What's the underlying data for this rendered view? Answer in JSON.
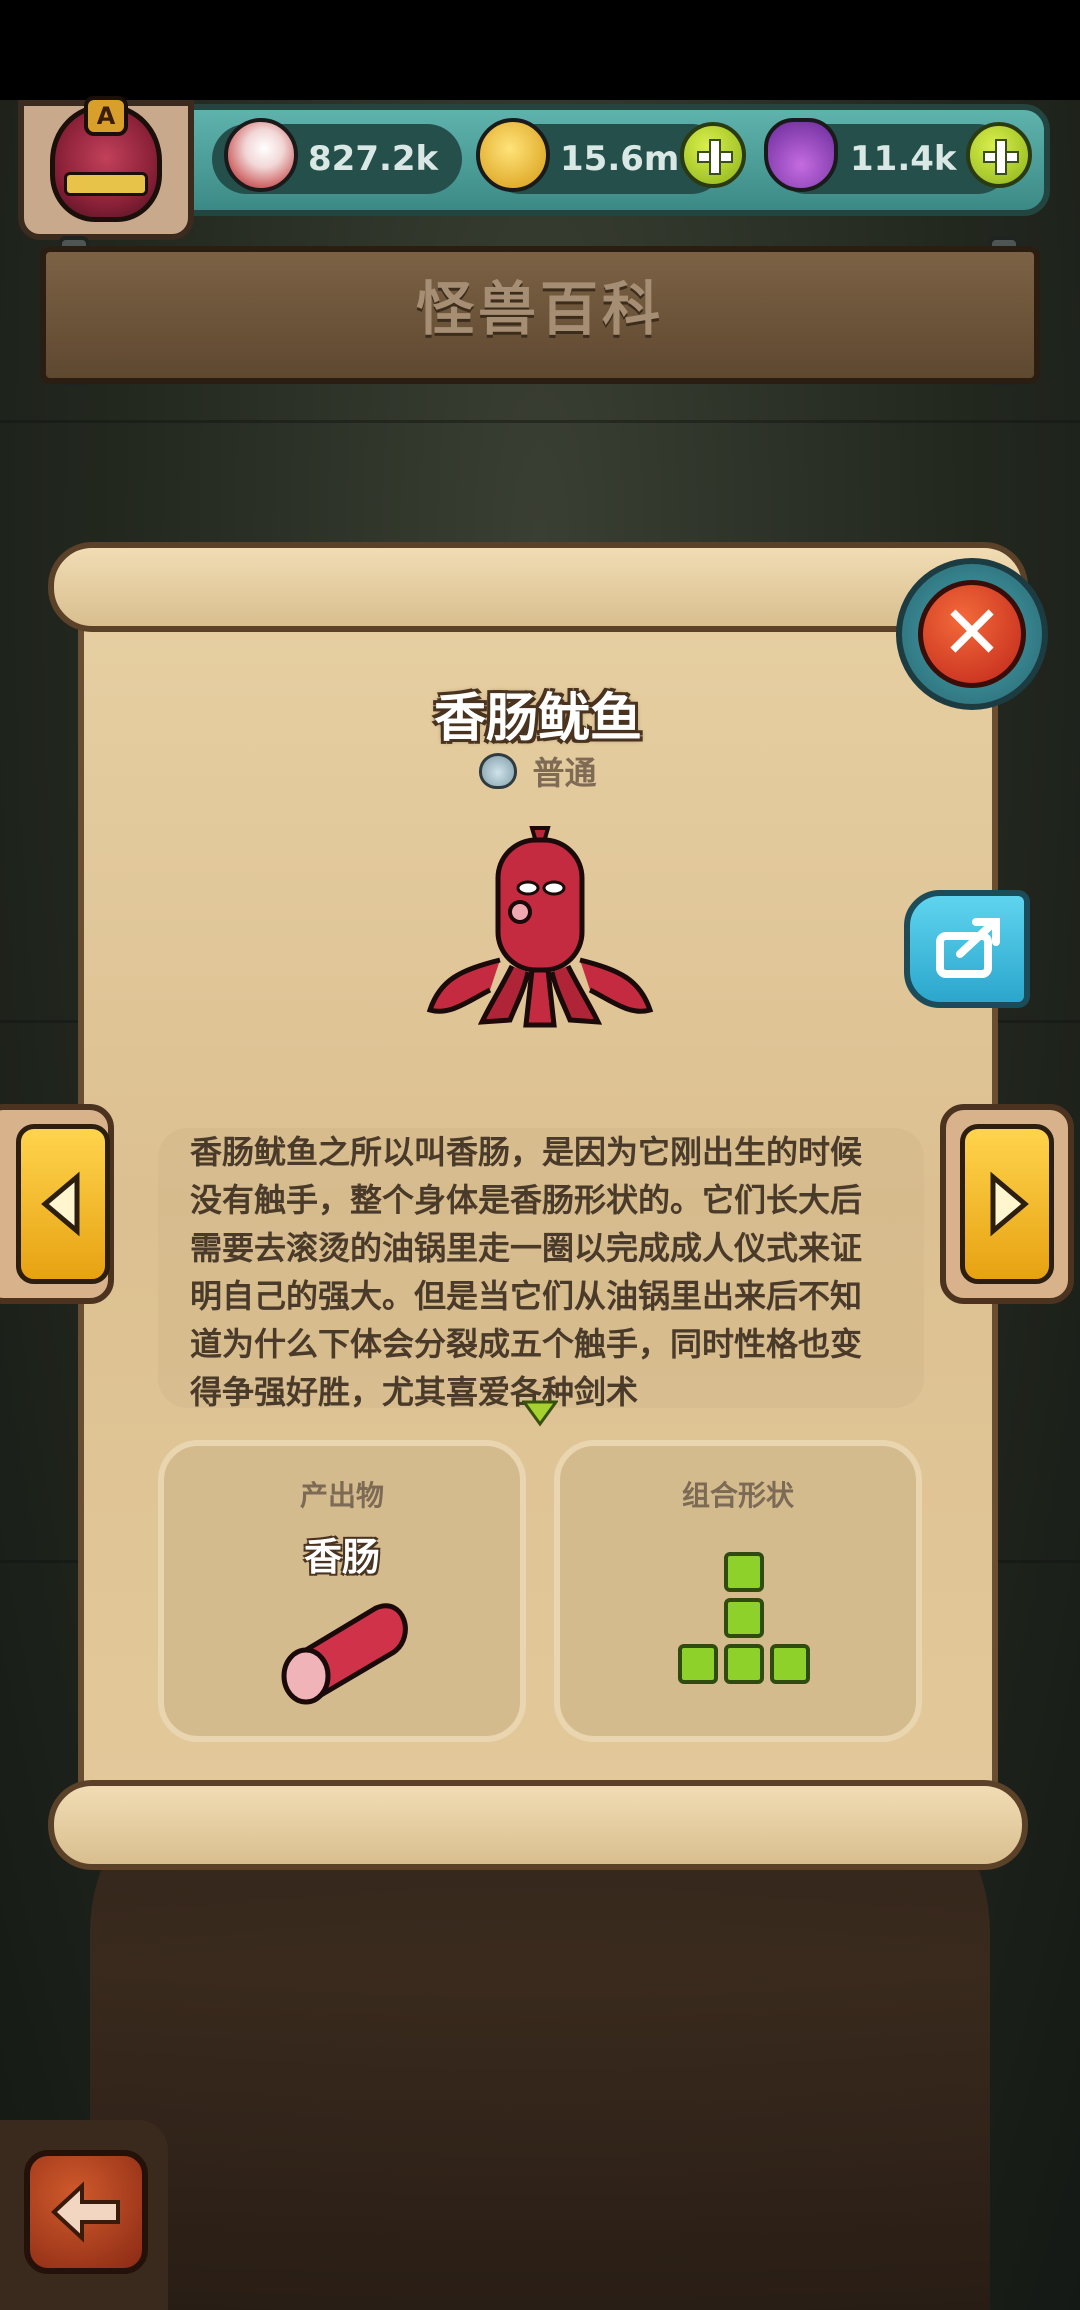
{
  "resources": {
    "eyeballs": "827.2k",
    "coins": "15.6m",
    "potions": "11.4k"
  },
  "avatar": {
    "rank": "A"
  },
  "page": {
    "title": "怪兽百科"
  },
  "monster": {
    "name": "香肠鱿鱼",
    "rarity": "普通",
    "description": "香肠鱿鱼之所以叫香肠，是因为它刚出生的时候没有触手，整个身体是香肠形状的。它们长大后需要去滚烫的油锅里走一圈以完成成人仪式来证明自己的强大。但是当它们从油锅里出来后不知道为什么下体会分裂成五个触手，同时性格也变得争强好胜，尤其喜爱各种剑术"
  },
  "cards": {
    "product": {
      "title": "产出物",
      "name": "香肠"
    },
    "shape": {
      "title": "组合形状",
      "cells": [
        [
          1,
          0
        ],
        [
          1,
          1
        ],
        [
          0,
          2
        ],
        [
          1,
          2
        ],
        [
          2,
          2
        ]
      ]
    }
  },
  "colors": {
    "accent_green": "#8fd12b",
    "close_red": "#d8361f",
    "arrow_yellow": "#ffd44d"
  },
  "icons": {
    "eyeball": "eyeball-icon",
    "coin": "coin-icon",
    "potion": "potion-icon",
    "add": "plus-icon",
    "close": "close-icon",
    "share": "share-icon",
    "prev": "chevron-left-icon",
    "next": "chevron-right-icon",
    "back": "back-arrow-icon",
    "more": "chevron-down-icon"
  }
}
